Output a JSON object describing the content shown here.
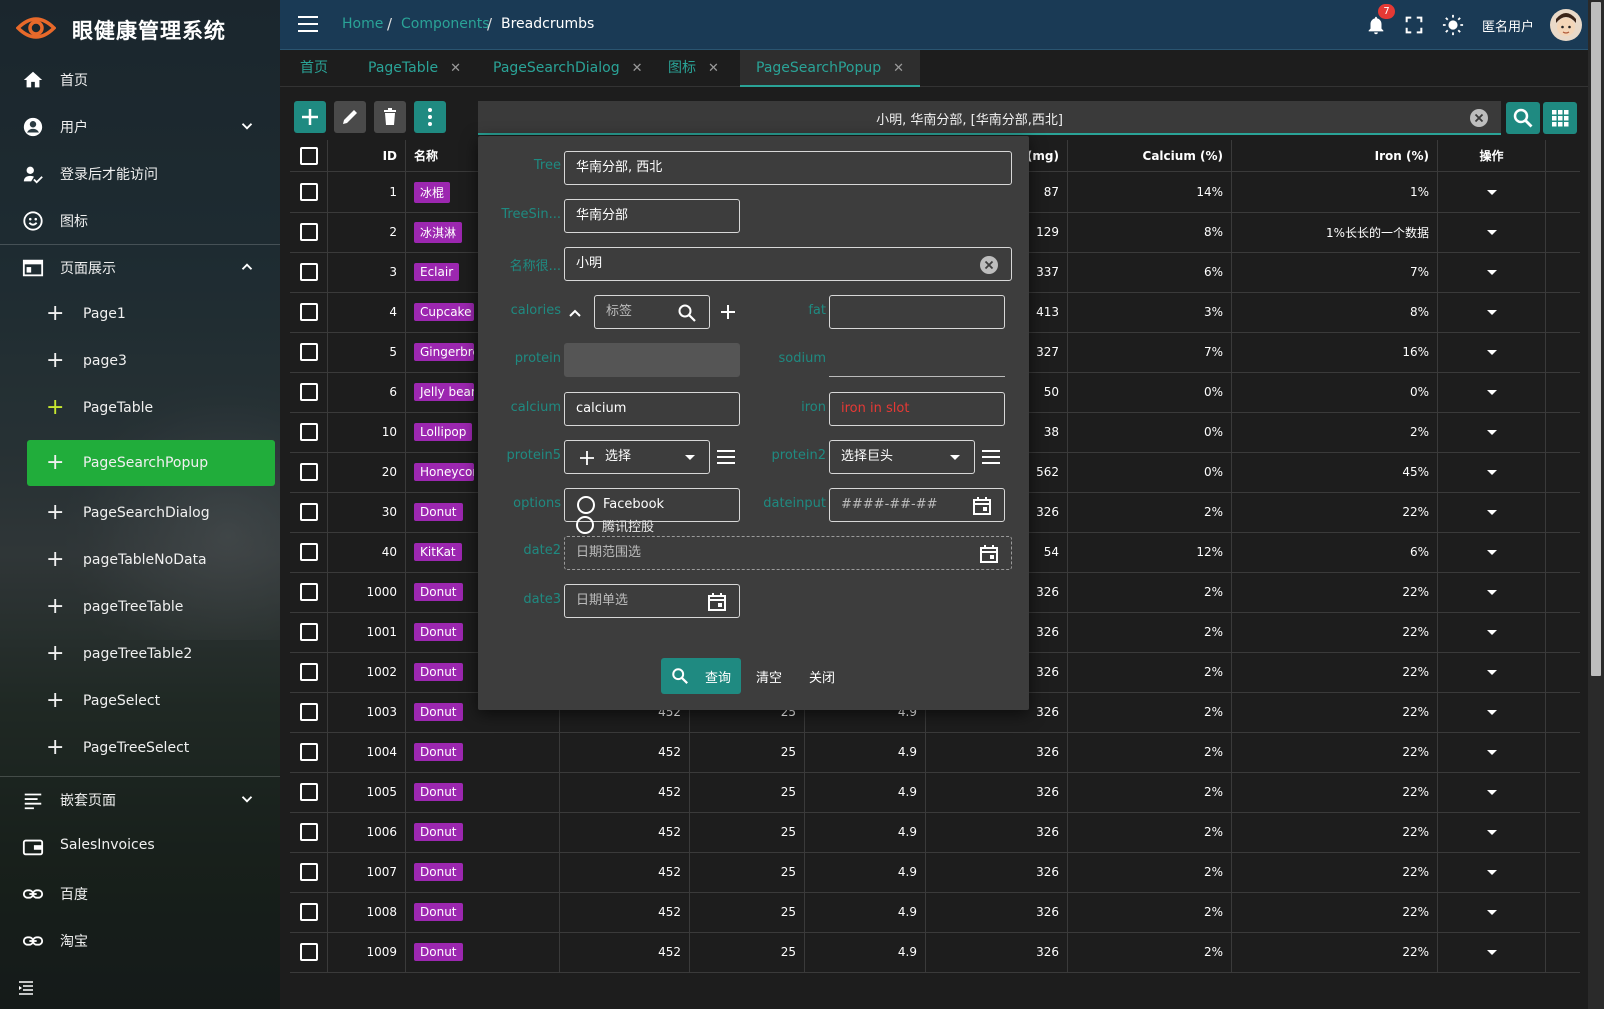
{
  "app": {
    "title": "眼健康管理系统"
  },
  "sidebar": {
    "items": [
      {
        "label": "首页"
      },
      {
        "label": "用户"
      },
      {
        "label": "登录后才能访问"
      },
      {
        "label": "图标"
      },
      {
        "label": "页面展示"
      },
      {
        "label": "嵌套页面"
      },
      {
        "label": "SalesInvoices"
      },
      {
        "label": "百度"
      },
      {
        "label": "淘宝"
      }
    ],
    "subitems": [
      "Page1",
      "page3",
      "PageTable",
      "PageSearchPopup",
      "PageSearchDialog",
      "pageTableNoData",
      "pageTreeTable",
      "pageTreeTable2",
      "PageSelect",
      "PageTreeSelect"
    ]
  },
  "header": {
    "breadcrumbs": [
      "Home",
      "Components",
      "Breadcrumbs"
    ],
    "notification_count": "7",
    "user_name": "匿名用户"
  },
  "tabs": [
    {
      "label": "首页"
    },
    {
      "label": "PageTable"
    },
    {
      "label": "PageSearchDialog"
    },
    {
      "label": "图标"
    },
    {
      "label": "PageSearchPopup"
    }
  ],
  "search": {
    "value": "小明, 华南分部, [华南分部,西北]"
  },
  "table": {
    "headers": [
      "ID",
      "名称",
      "dium (mg)",
      "Calcium (%)",
      "Iron (%)",
      "操作"
    ],
    "rows": [
      {
        "id": "1",
        "name": "冰棍",
        "cal": "",
        "fat": "",
        "carbs": "",
        "sodium": "87",
        "calcium": "14%",
        "iron": "1%"
      },
      {
        "id": "2",
        "name": "冰淇淋",
        "cal": "",
        "fat": "",
        "carbs": "",
        "sodium": "129",
        "calcium": "8%",
        "iron": "1%长长的一个数据"
      },
      {
        "id": "3",
        "name": "Eclair",
        "cal": "",
        "fat": "",
        "carbs": "",
        "sodium": "337",
        "calcium": "6%",
        "iron": "7%"
      },
      {
        "id": "4",
        "name": "Cupcake",
        "cal": "",
        "fat": "",
        "carbs": "",
        "sodium": "413",
        "calcium": "3%",
        "iron": "8%"
      },
      {
        "id": "5",
        "name": "Gingerbre",
        "cal": "",
        "fat": "",
        "carbs": "",
        "sodium": "327",
        "calcium": "7%",
        "iron": "16%"
      },
      {
        "id": "6",
        "name": "Jelly bean",
        "cal": "",
        "fat": "",
        "carbs": "",
        "sodium": "50",
        "calcium": "0%",
        "iron": "0%"
      },
      {
        "id": "10",
        "name": "Lollipop",
        "cal": "",
        "fat": "",
        "carbs": "",
        "sodium": "38",
        "calcium": "0%",
        "iron": "2%"
      },
      {
        "id": "20",
        "name": "Honeycom",
        "cal": "",
        "fat": "",
        "carbs": "",
        "sodium": "562",
        "calcium": "0%",
        "iron": "45%"
      },
      {
        "id": "30",
        "name": "Donut",
        "cal": "",
        "fat": "",
        "carbs": "",
        "sodium": "326",
        "calcium": "2%",
        "iron": "22%"
      },
      {
        "id": "40",
        "name": "KitKat",
        "cal": "",
        "fat": "",
        "carbs": "",
        "sodium": "54",
        "calcium": "12%",
        "iron": "6%"
      },
      {
        "id": "1000",
        "name": "Donut",
        "cal": "",
        "fat": "",
        "carbs": "",
        "sodium": "326",
        "calcium": "2%",
        "iron": "22%"
      },
      {
        "id": "1001",
        "name": "Donut",
        "cal": "",
        "fat": "",
        "carbs": "",
        "sodium": "326",
        "calcium": "2%",
        "iron": "22%"
      },
      {
        "id": "1002",
        "name": "Donut",
        "cal": "",
        "fat": "",
        "carbs": "",
        "sodium": "326",
        "calcium": "2%",
        "iron": "22%"
      },
      {
        "id": "1003",
        "name": "Donut",
        "cal": "452",
        "fat": "25",
        "carbs": "4.9",
        "sodium": "326",
        "calcium": "2%",
        "iron": "22%"
      },
      {
        "id": "1004",
        "name": "Donut",
        "cal": "452",
        "fat": "25",
        "carbs": "4.9",
        "sodium": "326",
        "calcium": "2%",
        "iron": "22%"
      },
      {
        "id": "1005",
        "name": "Donut",
        "cal": "452",
        "fat": "25",
        "carbs": "4.9",
        "sodium": "326",
        "calcium": "2%",
        "iron": "22%"
      },
      {
        "id": "1006",
        "name": "Donut",
        "cal": "452",
        "fat": "25",
        "carbs": "4.9",
        "sodium": "326",
        "calcium": "2%",
        "iron": "22%"
      },
      {
        "id": "1007",
        "name": "Donut",
        "cal": "452",
        "fat": "25",
        "carbs": "4.9",
        "sodium": "326",
        "calcium": "2%",
        "iron": "22%"
      },
      {
        "id": "1008",
        "name": "Donut",
        "cal": "452",
        "fat": "25",
        "carbs": "4.9",
        "sodium": "326",
        "calcium": "2%",
        "iron": "22%"
      },
      {
        "id": "1009",
        "name": "Donut",
        "cal": "452",
        "fat": "25",
        "carbs": "4.9",
        "sodium": "326",
        "calcium": "2%",
        "iron": "22%"
      }
    ]
  },
  "popup": {
    "labels": {
      "tree": "Tree",
      "tree_single": "TreeSin...",
      "name": "名称很...",
      "calories": "calories",
      "fat": "fat",
      "protein": "protein",
      "sodium": "sodium",
      "calcium": "calcium",
      "iron": "iron",
      "protein5": "protein5",
      "protein2": "protein2",
      "options": "options",
      "dateinput": "dateinput",
      "date2": "date2",
      "date3": "date3"
    },
    "values": {
      "tree": "华南分部, 西北",
      "tree_single": "华南分部",
      "name": "小明",
      "calories_placeholder": "标签",
      "calcium": "calcium",
      "iron": "iron in slot",
      "protein5": "选择",
      "protein2": "选择巨头",
      "option1": "Facebook",
      "option2": "腾讯控股",
      "dateinput": "####-##-##",
      "date2": "日期范围选",
      "date3": "日期单选"
    },
    "buttons": {
      "query": "查询",
      "clear": "清空",
      "close": "关闭"
    }
  },
  "colors": {
    "accent": "#1f8a81",
    "active_nav": "#21ad3b",
    "chip": "#9c27b0",
    "header": "#1a3a55"
  }
}
